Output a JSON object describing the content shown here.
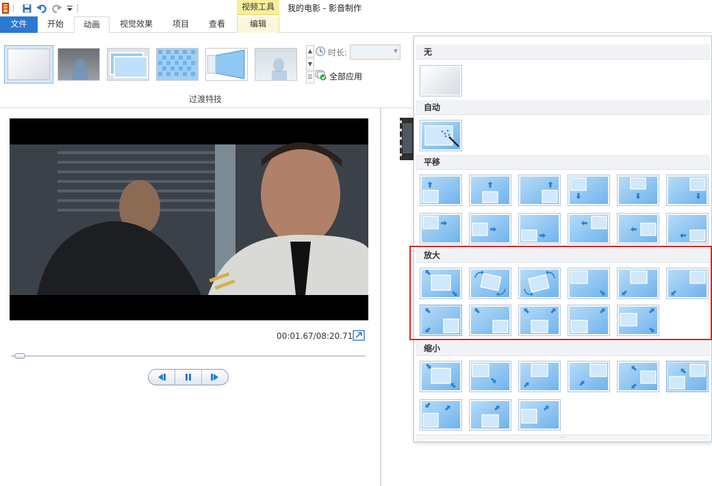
{
  "window": {
    "title": "我的电影 - 影音制作",
    "context_tab": "视频工具"
  },
  "tabs": [
    {
      "label": "文件"
    },
    {
      "label": "开始"
    },
    {
      "label": "动画"
    },
    {
      "label": "视觉效果"
    },
    {
      "label": "项目"
    },
    {
      "label": "查看"
    },
    {
      "label": "编辑"
    }
  ],
  "ribbon": {
    "group_label": "过渡特技",
    "duration_label": "时长:",
    "duration_value": "",
    "apply_all": "全部应用"
  },
  "player": {
    "timecode": "00:01.67/08:20.71",
    "seek_progress": 0.01
  },
  "panel": {
    "sections": [
      {
        "title": "无"
      },
      {
        "title": "自动"
      },
      {
        "title": "平移"
      },
      {
        "title": "放大"
      },
      {
        "title": "缩小"
      }
    ]
  },
  "colors": {
    "accent": "#2b79d0",
    "highlight": "#e02020",
    "tile_blue": "#8ec8f5"
  }
}
